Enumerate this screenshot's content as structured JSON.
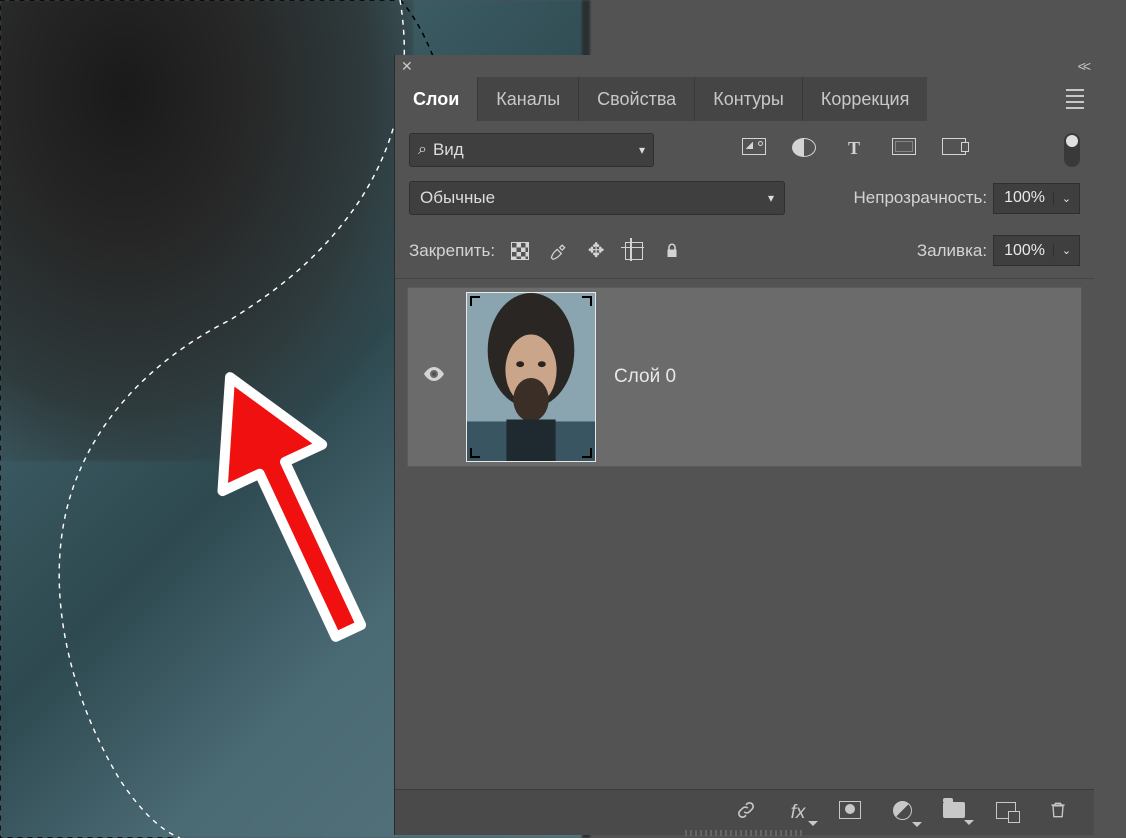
{
  "tabs": {
    "layers": "Слои",
    "channels": "Каналы",
    "properties": "Свойства",
    "paths": "Контуры",
    "adjustments": "Коррекция"
  },
  "search": {
    "label": "Вид"
  },
  "blend_mode": {
    "value": "Обычные"
  },
  "opacity": {
    "label": "Непрозрачность:",
    "value": "100%"
  },
  "lock": {
    "label": "Закрепить:"
  },
  "fill": {
    "label": "Заливка:",
    "value": "100%"
  },
  "layer": {
    "name": "Слой 0"
  },
  "bottom": {
    "fx": "fx"
  }
}
